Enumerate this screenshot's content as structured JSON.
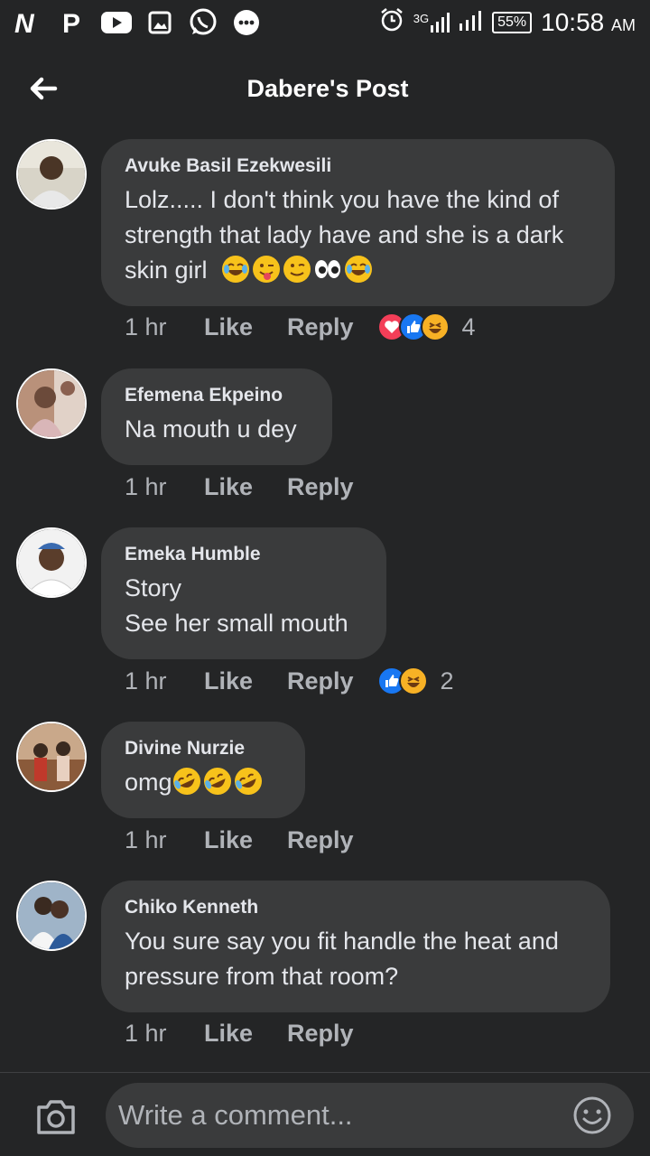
{
  "status_bar": {
    "app_icons": [
      "n-app-icon",
      "p-app-icon",
      "youtube-icon",
      "gallery-icon",
      "whatsapp-icon",
      "chat-dots-icon"
    ],
    "network": "3G",
    "battery": "55%",
    "time": "10:58",
    "ampm": "AM"
  },
  "header": {
    "title": "Dabere's Post"
  },
  "actions": {
    "like": "Like",
    "reply": "Reply"
  },
  "comments": [
    {
      "author": "Avuke Basil Ezekwesili",
      "lines": [
        "Lolz..... I don't think you have the kind of",
        "strength that lady have and she is a dark",
        "skin girl"
      ],
      "emojis": [
        "joy",
        "tongue-wink",
        "wink",
        "eyes",
        "joy"
      ],
      "time": "1 hr",
      "reactions": [
        "love",
        "like",
        "haha"
      ],
      "reaction_count": "4"
    },
    {
      "author": "Efemena Ekpeino",
      "lines": [
        "Na mouth u dey"
      ],
      "time": "1 hr"
    },
    {
      "author": "Emeka Humble",
      "lines": [
        "Story",
        "See her small mouth"
      ],
      "time": "1 hr",
      "reactions": [
        "like",
        "haha"
      ],
      "reaction_count": "2"
    },
    {
      "author": "Divine Nurzie",
      "lines": [
        "omg"
      ],
      "emojis": [
        "rofl",
        "rofl",
        "rofl"
      ],
      "time": "1 hr"
    },
    {
      "author": "Chiko Kenneth",
      "lines": [
        "You sure say you fit handle the heat and",
        "pressure from that room?"
      ],
      "time": "1 hr"
    }
  ],
  "composer": {
    "placeholder": "Write a comment..."
  },
  "colors": {
    "background": "#242526",
    "bubble": "#3a3b3c",
    "like_blue": "#1877f2",
    "love_red": "#f33e58",
    "haha_yellow": "#f7b125"
  }
}
